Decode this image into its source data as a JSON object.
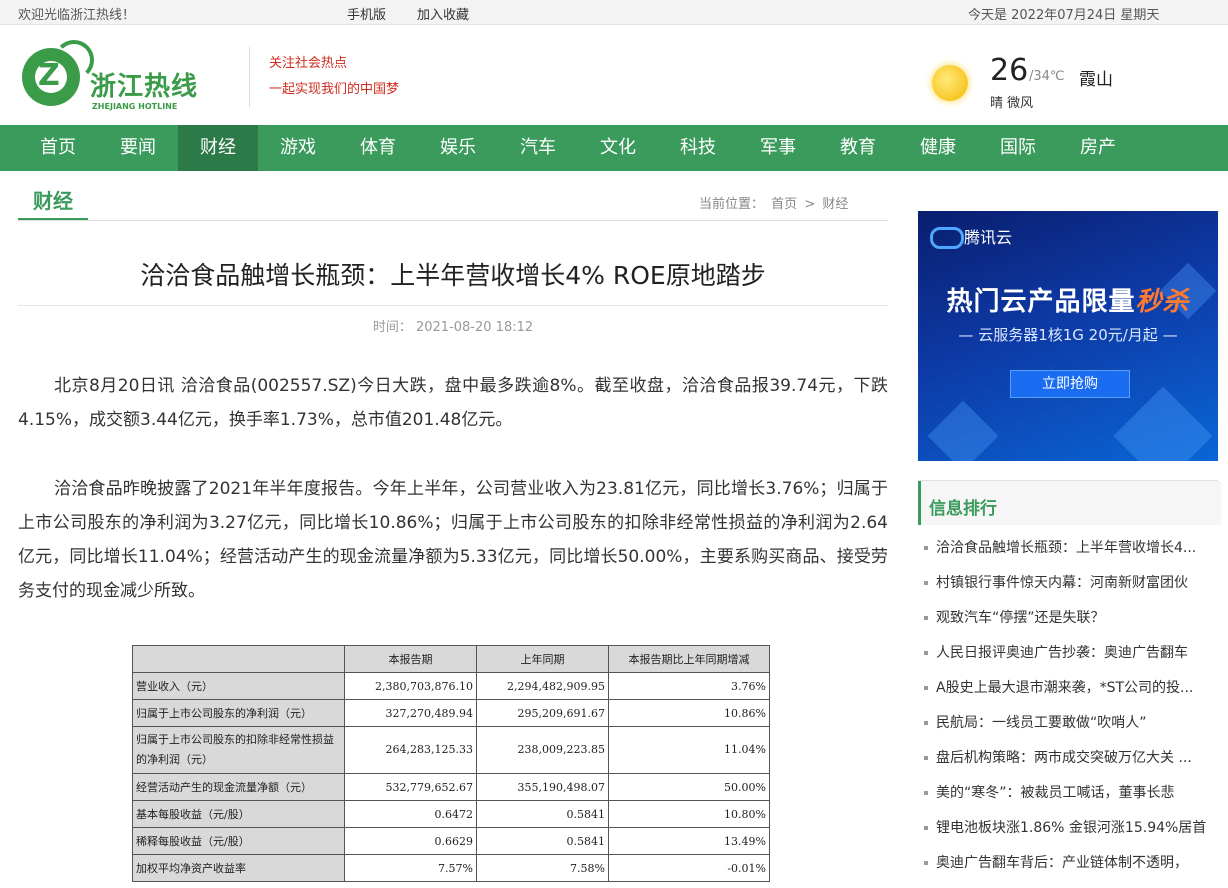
{
  "topbar": {
    "welcome": "欢迎光临浙江热线！",
    "mobile": "手机版",
    "favorite": "加入收藏",
    "date": "今天是 2022年07月24日 星期天"
  },
  "header": {
    "logo_cn": "浙江热线",
    "logo_en": "ZHEJIANG HOTLINE",
    "logo_letter": "Z",
    "slogan1": "关注社会热点",
    "slogan2": "一起实现我们的中国梦"
  },
  "weather": {
    "icon": "sun-icon",
    "temp": "26",
    "range": "/34℃",
    "city": "霞山",
    "desc": "晴 微风"
  },
  "nav": [
    "首页",
    "要闻",
    "财经",
    "游戏",
    "体育",
    "娱乐",
    "汽车",
    "文化",
    "科技",
    "军事",
    "教育",
    "健康",
    "国际",
    "房产"
  ],
  "nav_active": "财经",
  "section": {
    "name": "财经",
    "crumb_label": "当前位置：",
    "crumb_home": "首页",
    "crumb_sep": ">",
    "crumb_current": "财经"
  },
  "article": {
    "title": "洽洽食品触增长瓶颈：上半年营收增长4% ROE原地踏步",
    "meta": "时间： 2021-08-20 18:12",
    "p1": "北京8月20日讯 洽洽食品(002557.SZ)今日大跌，盘中最多跌逾8%。截至收盘，洽洽食品报39.74元，下跌4.15%，成交额3.44亿元，换手率1.73%，总市值201.48亿元。",
    "p2": "洽洽食品昨晚披露了2021年半年度报告。今年上半年，公司营业收入为23.81亿元，同比增长3.76%；归属于上市公司股东的净利润为3.27亿元，同比增长10.86%；归属于上市公司股东的扣除非经常性损益的净利润为2.64亿元，同比增长11.04%；经营活动产生的现金流量净额为5.33亿元，同比增长50.00%，主要系购买商品、接受劳务支付的现金减少所致。"
  },
  "table": {
    "headers": [
      "",
      "本报告期",
      "上年同期",
      "本报告期比上年同期增减"
    ],
    "rows": [
      [
        "营业收入（元）",
        "2,380,703,876.10",
        "2,294,482,909.95",
        "3.76%"
      ],
      [
        "归属于上市公司股东的净利润（元）",
        "327,270,489.94",
        "295,209,691.67",
        "10.86%"
      ],
      [
        "归属于上市公司股东的扣除非经常性损益的净利润（元）",
        "264,283,125.33",
        "238,009,223.85",
        "11.04%"
      ],
      [
        "经营活动产生的现金流量净额（元）",
        "532,779,652.67",
        "355,190,498.07",
        "50.00%"
      ],
      [
        "基本每股收益（元/股）",
        "0.6472",
        "0.5841",
        "10.80%"
      ],
      [
        "稀释每股收益（元/股）",
        "0.6629",
        "0.5841",
        "13.49%"
      ],
      [
        "加权平均净资产收益率",
        "7.57%",
        "7.58%",
        "-0.01%"
      ]
    ]
  },
  "ad": {
    "brand": "腾讯云",
    "headline_a": "热门云产品限量",
    "headline_b": "秒杀",
    "sub": "— 云服务器1核1G   20元/月起 —",
    "button": "立即抢购"
  },
  "ranking": {
    "title": "信息排行",
    "items": [
      "洽洽食品触增长瓶颈：上半年营收增长4...",
      "村镇银行事件惊天内幕：河南新财富团伙",
      "观致汽车“停摆”还是失联？",
      "人民日报评奥迪广告抄袭：奥迪广告翻车",
      "A股史上最大退市潮来袭，*ST公司的投...",
      "民航局：一线员工要敢做“吹哨人”",
      "盘后机构策略：两市成交突破万亿大关 ...",
      "美的“寒冬”：被裁员工喊话，董事长悲",
      "锂电池板块涨1.86% 金银河涨15.94%居首",
      "奥迪广告翻车背后：产业链体制不透明，"
    ]
  }
}
